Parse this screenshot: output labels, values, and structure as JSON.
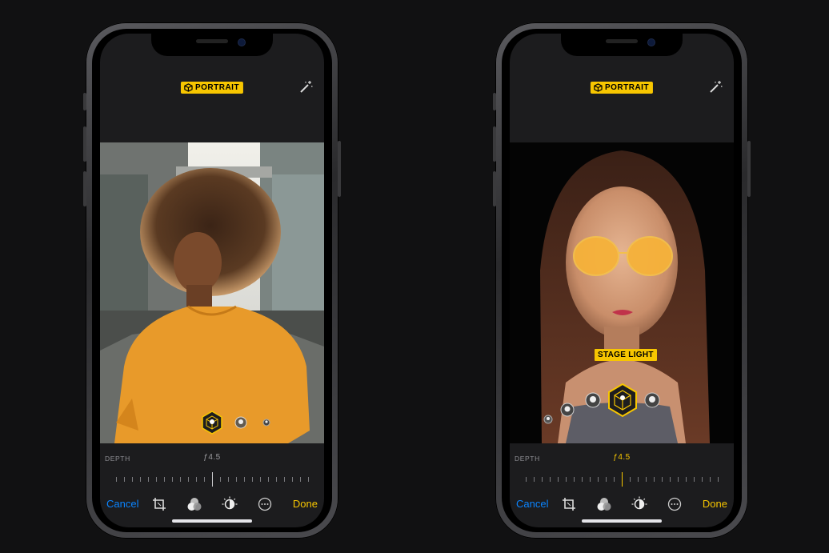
{
  "left_phone": {
    "mode_label": "PORTRAIT",
    "depth_label": "DEPTH",
    "fstop": "ƒ4.5",
    "cancel_label": "Cancel",
    "done_label": "Done",
    "depth_value": "ƒ4.5"
  },
  "right_phone": {
    "mode_label": "PORTRAIT",
    "stage_light_label": "STAGE LIGHT",
    "depth_label": "DEPTH",
    "fstop": "ƒ4.5",
    "cancel_label": "Cancel",
    "done_label": "Done"
  },
  "colors": {
    "accent_yellow": "#f7c600",
    "cancel_blue": "#0a84ff",
    "background": "#111112"
  },
  "icons": [
    "cube-icon",
    "magic-wand-icon",
    "crop-icon",
    "filters-icon",
    "adjust-icon",
    "more-icon",
    "lighting-icon"
  ]
}
